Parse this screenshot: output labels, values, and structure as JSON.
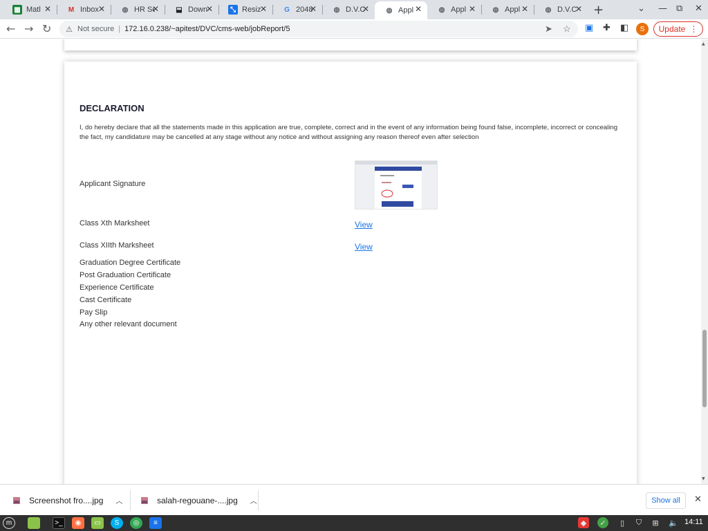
{
  "browser": {
    "tabs": [
      {
        "title": "Matl",
        "icon": "sheets-icon",
        "color": "#188038"
      },
      {
        "title": "Inbox",
        "icon": "gmail-icon",
        "color": "#d93025"
      },
      {
        "title": "HR Se",
        "icon": "globe-icon",
        "color": "#5f6368"
      },
      {
        "title": "Down",
        "icon": "download-site-icon",
        "color": "#202124"
      },
      {
        "title": "Resiz",
        "icon": "resize-icon",
        "color": "#1a73e8"
      },
      {
        "title": "2048",
        "icon": "google-icon",
        "color": "#4285f4"
      },
      {
        "title": "D.V.C",
        "icon": "globe-icon",
        "color": "#5f6368"
      },
      {
        "title": "Appl",
        "icon": "globe-icon",
        "color": "#5f6368",
        "active": true
      },
      {
        "title": "Appl",
        "icon": "globe-icon",
        "color": "#5f6368"
      },
      {
        "title": "Appl",
        "icon": "globe-icon",
        "color": "#5f6368"
      },
      {
        "title": "D.V.C",
        "icon": "globe-icon",
        "color": "#5f6368"
      }
    ],
    "omnibox": {
      "security_label": "Not secure",
      "separator": "|",
      "url": "172.16.0.238/~apitest/DVC/cms-web/jobReport/5"
    },
    "profile_initial": "S",
    "update_label": "Update"
  },
  "page": {
    "declaration": {
      "heading": "DECLARATION",
      "text": "I, do hereby declare that all the statements made in this application are true, complete, correct and in the event of any information being found false, incomplete, incorrect or concealing the fact, my candidature may be cancelled at any stage without any notice and without assigning any reason thereof even after selection"
    },
    "signature_label": "Applicant Signature",
    "documents": [
      {
        "label": "Class Xth Marksheet",
        "link": "View"
      },
      {
        "label": "Class XIIth Marksheet",
        "link": "View"
      },
      {
        "label": "Graduation Degree Certificate"
      },
      {
        "label": "Post Graduation Certificate"
      },
      {
        "label": "Experience Certificate"
      },
      {
        "label": "Cast Certificate"
      },
      {
        "label": "Pay Slip"
      },
      {
        "label": "Any other relevant document"
      }
    ]
  },
  "downloads": {
    "items": [
      {
        "name": "Screenshot fro....jpg"
      },
      {
        "name": "salah-regouane-....jpg"
      }
    ],
    "show_all": "Show all"
  },
  "taskbar": {
    "clock": "14:11",
    "accent": "#2f2f2f"
  }
}
